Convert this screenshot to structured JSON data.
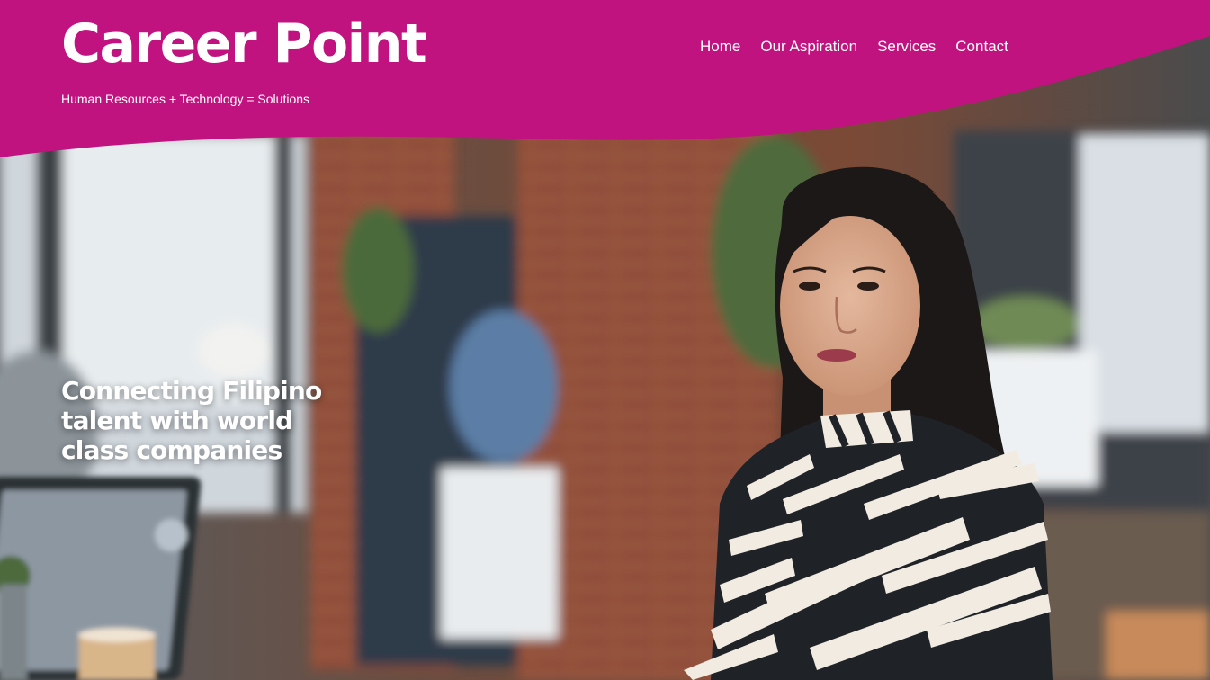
{
  "site": {
    "brand_name": "Career Point",
    "tagline": "Human Resources + Technology = Solutions"
  },
  "nav": {
    "items": [
      {
        "label": "Home",
        "name": "nav-home"
      },
      {
        "label": "Our Aspiration",
        "name": "nav-our-aspiration"
      },
      {
        "label": "Services",
        "name": "nav-services"
      },
      {
        "label": "Contact",
        "name": "nav-contact"
      }
    ]
  },
  "hero": {
    "headline": "Connecting Filipino talent with world class companies"
  },
  "colors": {
    "brand": "#c0137f",
    "text_on_brand": "#ffffff"
  }
}
